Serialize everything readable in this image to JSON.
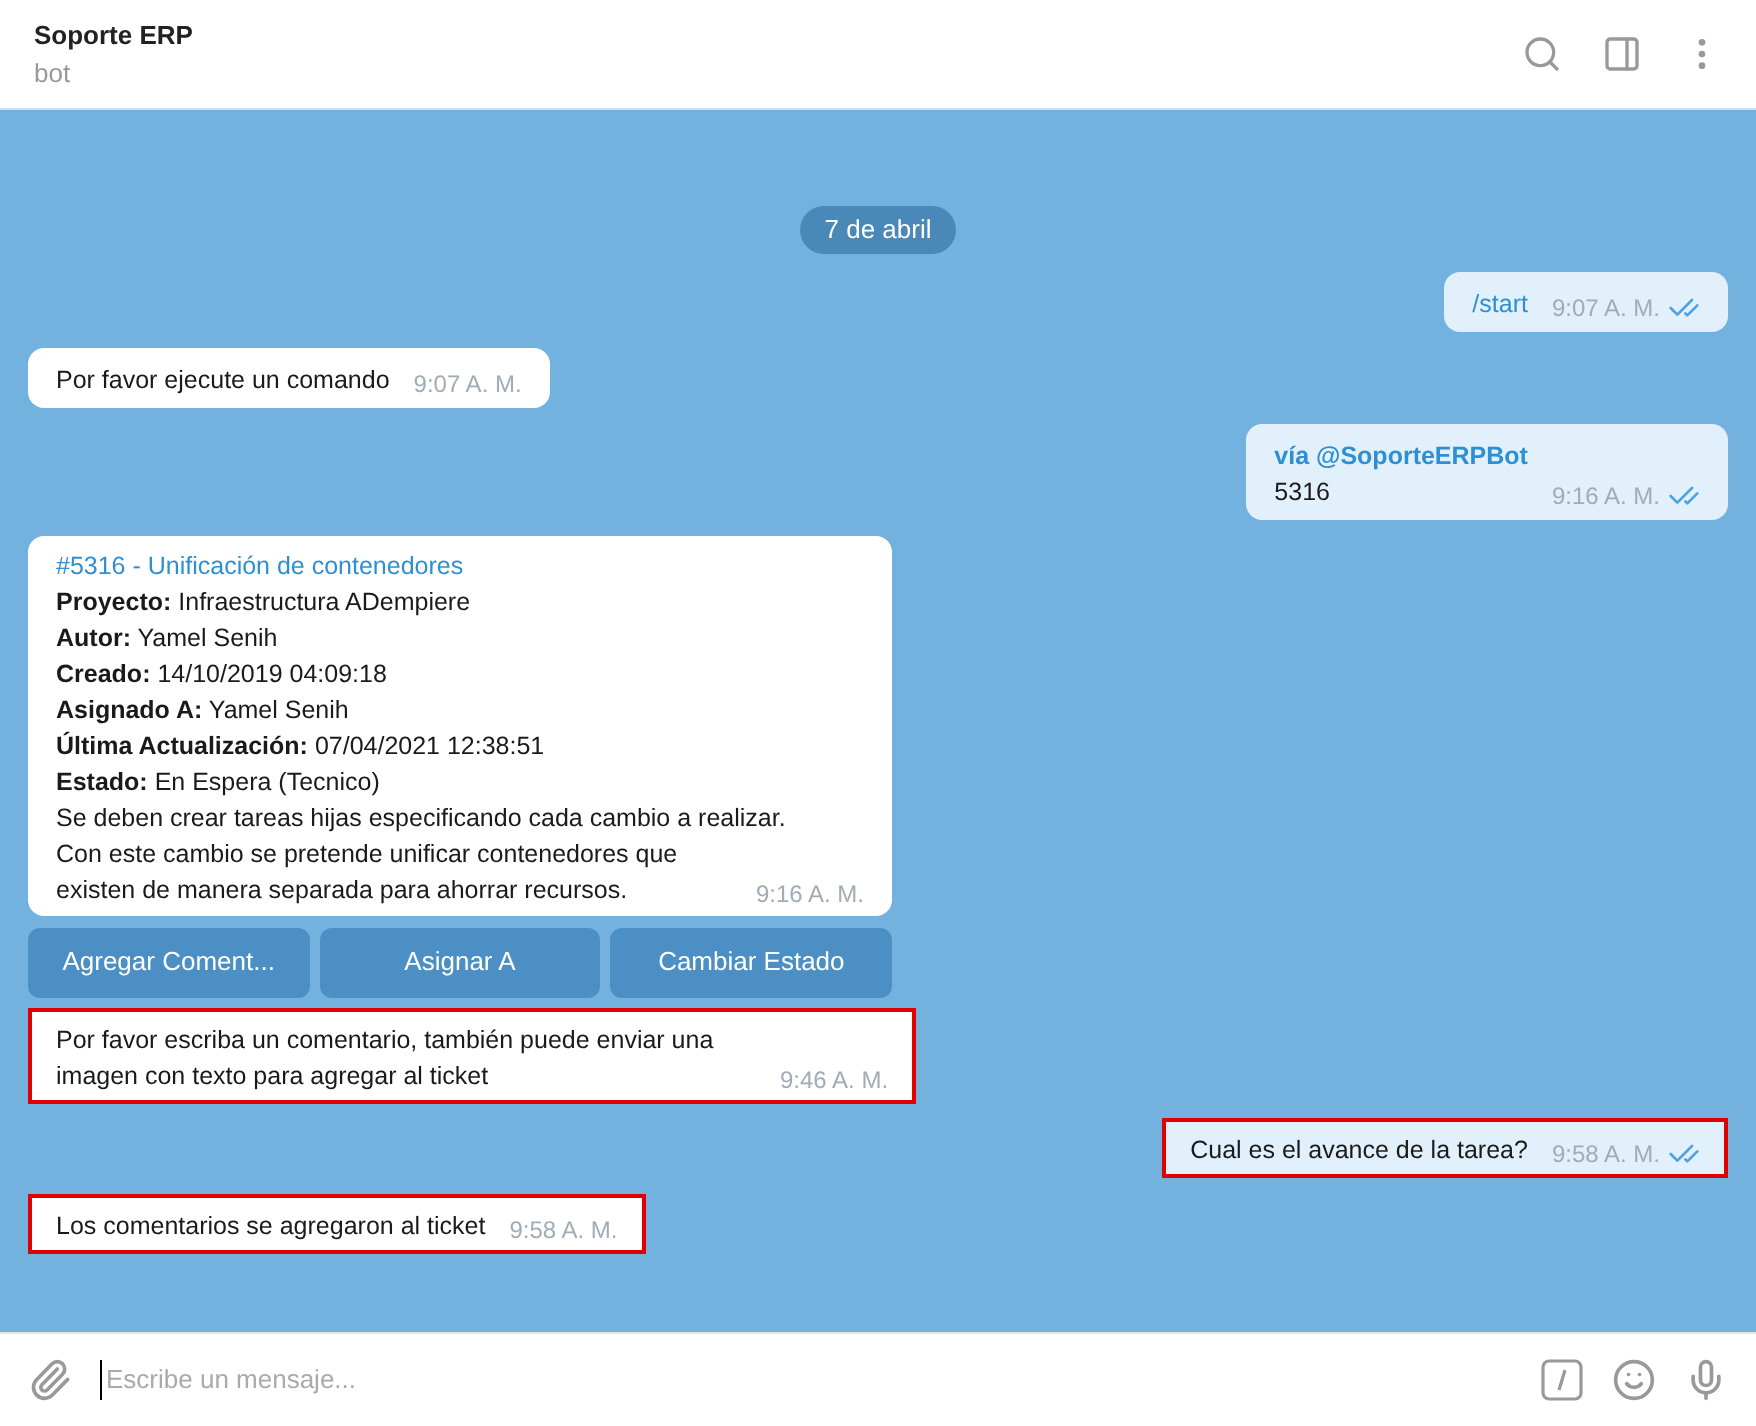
{
  "header": {
    "title": "Soporte ERP",
    "subtitle": "bot"
  },
  "date_badge": "7 de abril",
  "messages": [
    {
      "kind": "command",
      "outgoing": true,
      "text": "/start",
      "time": "9:07 A. M.",
      "read": true,
      "highlighted": false
    },
    {
      "kind": "text",
      "outgoing": false,
      "text": "Por favor ejecute un comando",
      "time": "9:07 A. M.",
      "highlighted": false
    },
    {
      "kind": "via",
      "outgoing": true,
      "via": "vía @SoporteERPBot",
      "text": "5316",
      "time": "9:16 A. M.",
      "read": true,
      "highlighted": false
    },
    {
      "kind": "card",
      "outgoing": false,
      "title": "#5316 - Unificación de contenedores",
      "fields": [
        {
          "label": "Proyecto:",
          "value": "Infraestructura ADempiere"
        },
        {
          "label": "Autor:",
          "value": "Yamel Senih"
        },
        {
          "label": "Creado:",
          "value": "14/10/2019 04:09:18"
        },
        {
          "label": "Asignado A:",
          "value": "Yamel Senih"
        },
        {
          "label": "Última Actualización:",
          "value": "07/04/2021 12:38:51"
        },
        {
          "label": "Estado:",
          "value": "En Espera (Tecnico)"
        }
      ],
      "body": [
        "Se deben crear tareas hijas especificando cada cambio a realizar.",
        "Con este cambio se pretende unificar contenedores que existen de manera separada para ahorrar recursos."
      ],
      "time": "9:16 A. M.",
      "buttons": [
        "Agregar Coment...",
        "Asignar A",
        "Cambiar Estado"
      ],
      "highlighted": false
    },
    {
      "kind": "text",
      "outgoing": false,
      "text": "Por favor escriba un comentario, también puede enviar una imagen con texto para agregar al ticket",
      "time": "9:46 A. M.",
      "highlighted": true
    },
    {
      "kind": "text",
      "outgoing": true,
      "text": "Cual es el avance de la tarea?",
      "time": "9:58 A. M.",
      "read": true,
      "highlighted": true
    },
    {
      "kind": "text",
      "outgoing": false,
      "text": "Los comentarios se agregaron al ticket",
      "time": "9:58 A. M.",
      "highlighted": true
    }
  ],
  "composer": {
    "placeholder": "Escribe un mensaje..."
  }
}
